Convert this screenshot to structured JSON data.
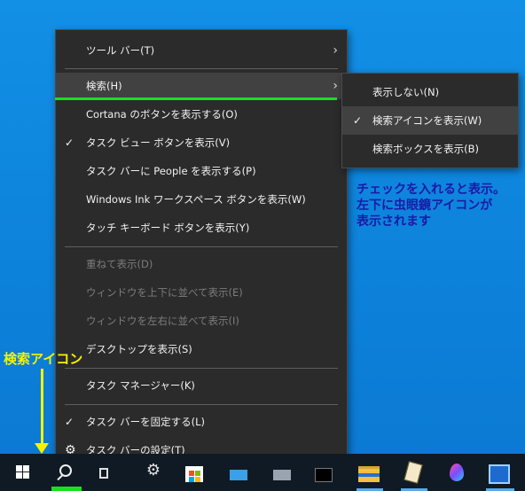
{
  "context_menu": {
    "items": [
      {
        "label": "ツール バー(T)"
      },
      {
        "label": "検索(H)"
      },
      {
        "label": "Cortana のボタンを表示する(O)"
      },
      {
        "label": "タスク ビュー ボタンを表示(V)"
      },
      {
        "label": "タスク バーに People を表示する(P)"
      },
      {
        "label": "Windows Ink ワークスペース ボタンを表示(W)"
      },
      {
        "label": "タッチ キーボード ボタンを表示(Y)"
      },
      {
        "label": "重ねて表示(D)"
      },
      {
        "label": "ウィンドウを上下に並べて表示(E)"
      },
      {
        "label": "ウィンドウを左右に並べて表示(I)"
      },
      {
        "label": "デスクトップを表示(S)"
      },
      {
        "label": "タスク マネージャー(K)"
      },
      {
        "label": "タスク バーを固定する(L)"
      },
      {
        "label": "タスク バーの設定(T)"
      }
    ]
  },
  "search_submenu": {
    "items": [
      {
        "label": "表示しない(N)"
      },
      {
        "label": "検索アイコンを表示(W)"
      },
      {
        "label": "検索ボックスを表示(B)"
      }
    ]
  },
  "annotations": {
    "note_line1": "チェックを入れると表示。",
    "note_line2": "左下に虫眼鏡アイコンが",
    "note_line3": "表示されます",
    "search_icon_label": "検索アイコン"
  },
  "glyphs": {
    "check": "✓",
    "arrow": "›",
    "gear": "⚙"
  },
  "colors": {
    "menu_bg": "#2b2b2b",
    "highlight_line": "#19e01e",
    "annotation_blue": "#1a1aa6",
    "annotation_yellow": "#f7f200",
    "taskbar_bg": "#101a24"
  },
  "taskbar": {
    "icons": [
      "windows-start-icon",
      "search-icon",
      "task-view-icon",
      "settings-icon",
      "store-icon",
      "mail-icon",
      "network-icon",
      "command-prompt-icon",
      "file-explorer-icon",
      "text-editor-icon",
      "paint-drop-icon",
      "cpu-info-icon"
    ]
  }
}
